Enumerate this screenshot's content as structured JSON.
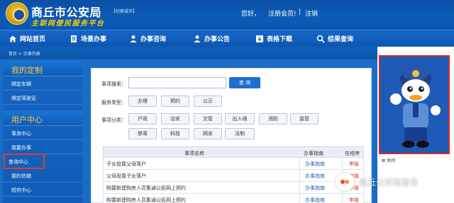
{
  "header": {
    "title": "商丘市公安局",
    "switch_city": "【切换城市】",
    "slogan": "主联网便民服务平台",
    "hello": "您好，",
    "register": "注册会员!",
    "separator": "|",
    "logout": "注销"
  },
  "nav": [
    {
      "label": "网站首页",
      "icon": "home-icon"
    },
    {
      "label": "场景办事",
      "icon": "document-icon"
    },
    {
      "label": "办事咨询",
      "icon": "user-icon"
    },
    {
      "label": "办事公告",
      "icon": "person-icon"
    },
    {
      "label": "表格下载",
      "icon": "download-icon"
    },
    {
      "label": "结果查询",
      "icon": "search-icon"
    }
  ],
  "breadcrumb": "首页 > 办事列表",
  "sidebar": {
    "section1": "我的定制",
    "items1": [
      "绑定车辆",
      "绑定驾驶证"
    ],
    "section2": "用户中心",
    "items2": [
      "事务中心",
      "我要办事",
      "查询中心",
      "我的信箱",
      "短信中心"
    ]
  },
  "search": {
    "label": "事项搜索：",
    "button": "查 询"
  },
  "service_types": {
    "label": "服务类型：",
    "options": [
      "办理",
      "预约",
      "公示"
    ]
  },
  "categories": {
    "label": "事项分类：",
    "row1": [
      "户政",
      "治安",
      "交管",
      "出入境",
      "消防",
      "监管"
    ],
    "row2": [
      "禁毒",
      "科技",
      "网安",
      "法制"
    ]
  },
  "table": {
    "headers": [
      "事项名称",
      "办事指南",
      "在线申办"
    ],
    "rows": [
      {
        "name": "子女投靠父母落户",
        "guide": "办事指南",
        "apply": "申报"
      },
      {
        "name": "父母投靠子女落户",
        "guide": "办事指南",
        "apply": "申报"
      },
      {
        "name": "购置新建购房人员集通公民网上预约",
        "guide": "办事指南",
        "apply": "申报"
      },
      {
        "name": "购置新建购房人员集通公民网上预约",
        "guide": "办事指南",
        "apply": "申报"
      }
    ]
  },
  "ad_close": "关闭",
  "watermark": "商丘公安微警务",
  "colors": {
    "header_blue": "#0b5cb6",
    "accent_yellow": "#ffcc00",
    "highlight_red": "#e23c2a"
  }
}
